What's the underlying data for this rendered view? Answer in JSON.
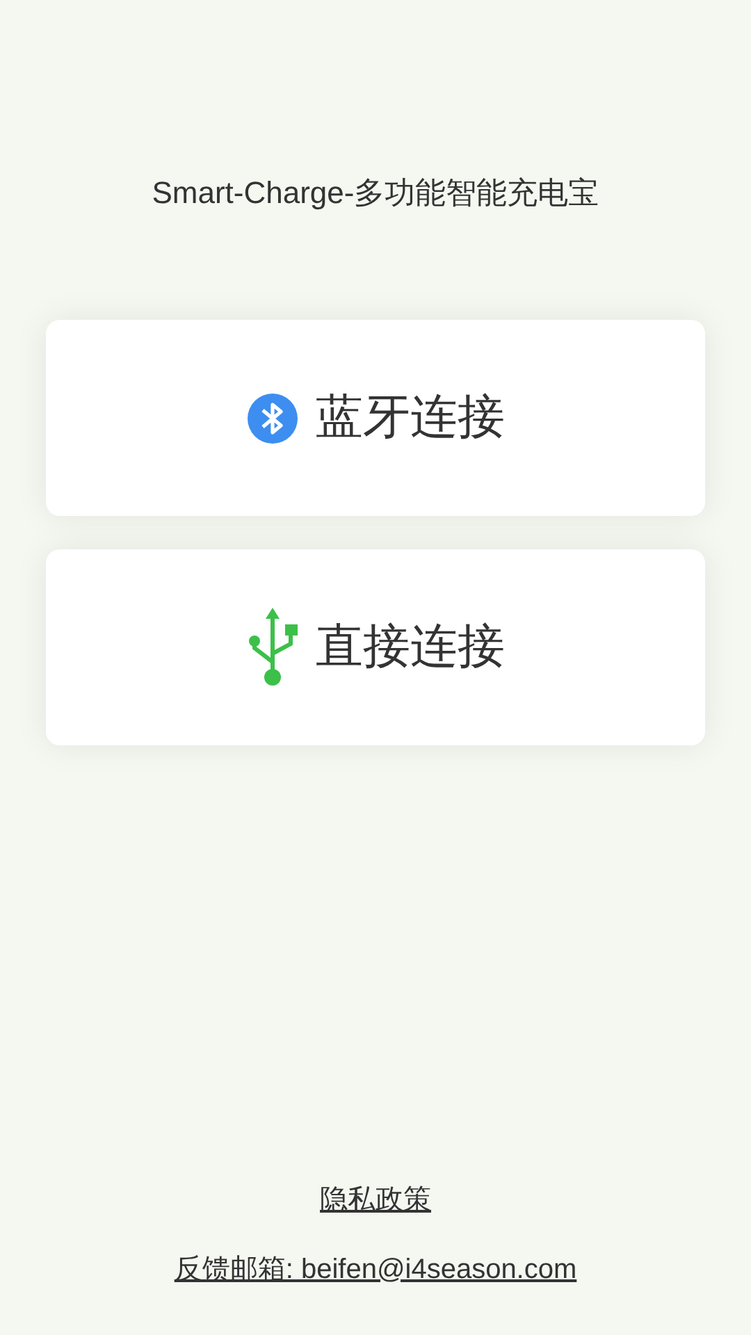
{
  "title": "Smart-Charge-多功能智能充电宝",
  "options": [
    {
      "kind": "bluetooth",
      "label": "蓝牙连接"
    },
    {
      "kind": "usb",
      "label": "直接连接"
    }
  ],
  "links": [
    "隐私政策",
    "反馈邮箱: beifen@i4season.com"
  ]
}
